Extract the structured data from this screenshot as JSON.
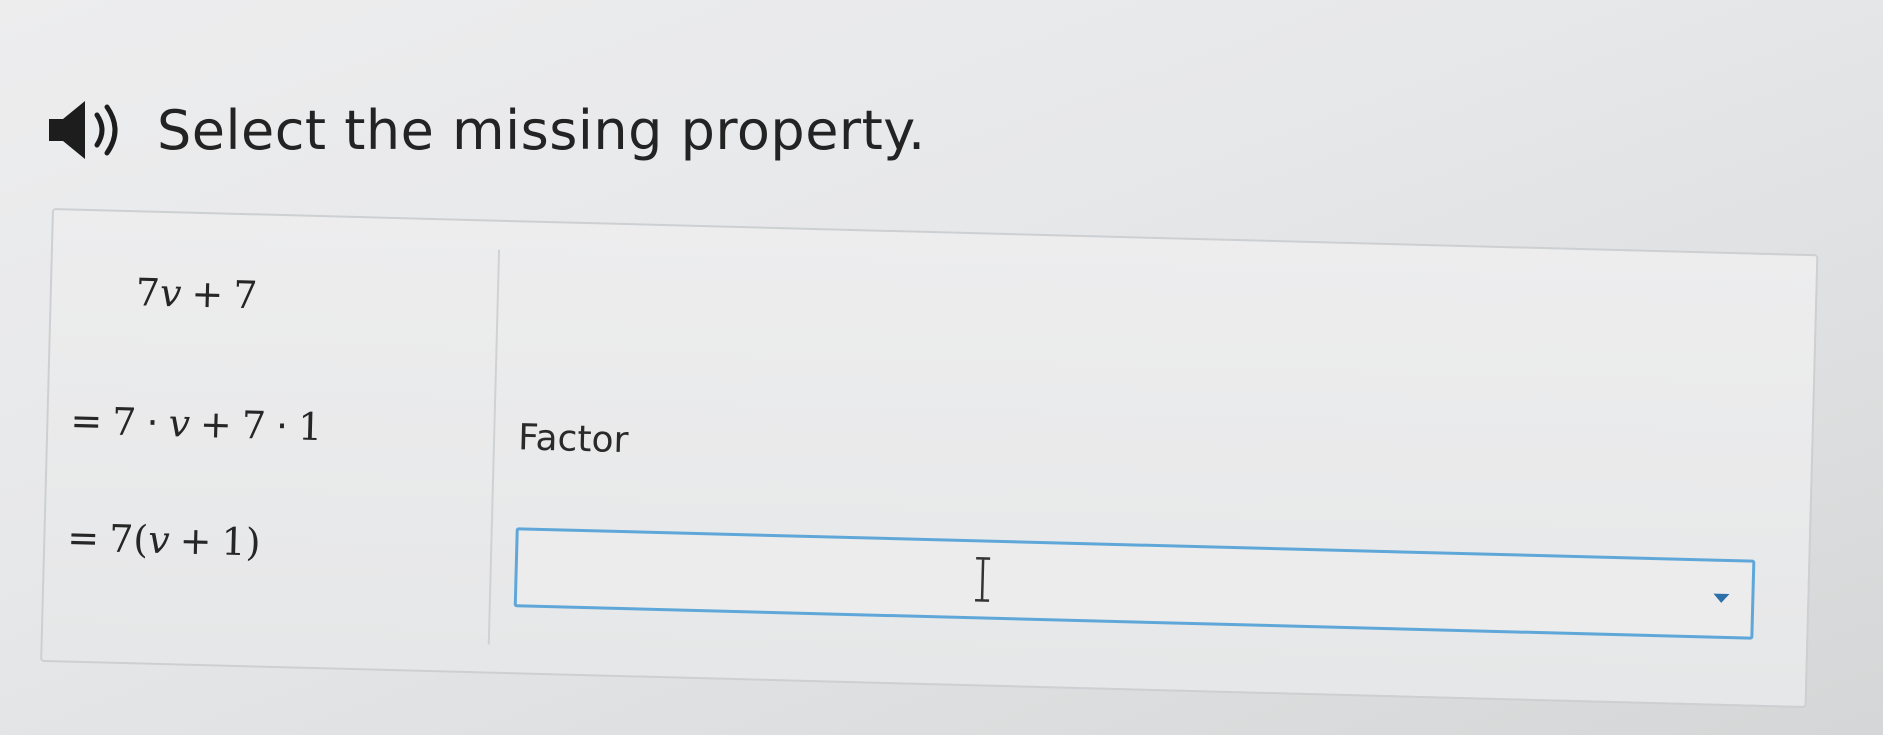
{
  "prompt": {
    "text": "Select the missing property."
  },
  "icons": {
    "audio": "speaker-icon",
    "dropdown": "chevron-down-icon",
    "cursor": "text-cursor-icon"
  },
  "steps": [
    {
      "expression": {
        "a": "7",
        "var": "v",
        "op": "+",
        "b": "7"
      }
    },
    {
      "expression": {
        "eq": "=",
        "a": "7",
        "dot1": "·",
        "var": "v",
        "op": "+",
        "b": "7",
        "dot2": "·",
        "c": "1"
      },
      "reason": "Factor"
    },
    {
      "expression": {
        "eq": "=",
        "a": "7",
        "open": "(",
        "var": "v",
        "op": "+",
        "b": "1",
        "close": ")"
      },
      "reason_select": {
        "value": ""
      }
    }
  ],
  "colors": {
    "select_border": "#5fa7d8",
    "chevron": "#2d6fa8"
  }
}
